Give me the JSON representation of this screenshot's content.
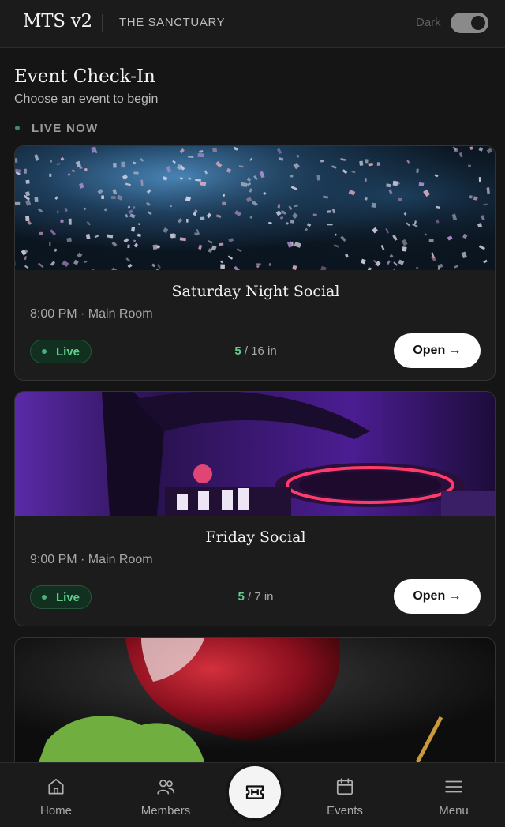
{
  "header": {
    "brand": "MTS v2",
    "venue": "THE SANCTUARY",
    "theme_label": "Dark",
    "theme_on": true
  },
  "page": {
    "title": "Event Check-In",
    "subtitle": "Choose an event to begin",
    "section_label": "LIVE NOW"
  },
  "events": [
    {
      "title": "Saturday Night Social",
      "meta": "8:00 PM · Main Room",
      "status": "Live",
      "checked_in": "5",
      "capacity_text": " / 16 in",
      "button": "Open →",
      "image": "confetti-party"
    },
    {
      "title": "Friday Social",
      "meta": "9:00 PM · Main Room",
      "status": "Live",
      "checked_in": "5",
      "capacity_text": " / 7 in",
      "button": "Open →",
      "image": "dj-turntable"
    },
    {
      "image": "red-wine-glass"
    }
  ],
  "nav": {
    "home": "Home",
    "members": "Members",
    "center_icon": "ticket-icon",
    "events": "Events",
    "menu": "Menu"
  },
  "colors": {
    "background": "#151515",
    "live_green": "#5fcf8c",
    "card": "#1c1c1c"
  }
}
